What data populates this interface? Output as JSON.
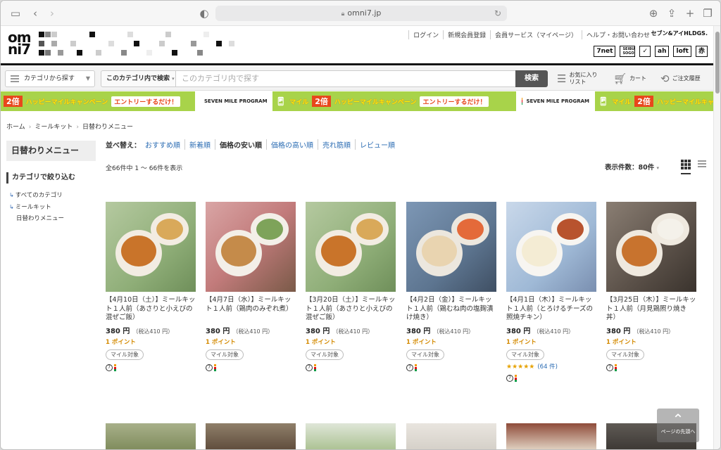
{
  "browser": {
    "url": "omni7.jp"
  },
  "header": {
    "logo_top": "om",
    "logo_bottom": "ni7",
    "links": [
      "ログイン",
      "新規会員登録",
      "会員サービス（マイページ）",
      "ヘルプ・お問い合わせ"
    ],
    "group_logo": "セブン&アイHLDGS.",
    "brands": [
      "7net",
      "SEIBU SOGO",
      "✓",
      "ah",
      "loft",
      "赤"
    ]
  },
  "search": {
    "category_button": "カテゴリから探す",
    "scope_button": "このカテゴリ内で検索",
    "placeholder": "このカテゴリ内で探す",
    "submit": "検索",
    "favorites": "お気に入り リスト",
    "cart": "カート",
    "history": "ご注文履歴"
  },
  "banner": {
    "mile": "マイル",
    "twice": "2倍",
    "campaign": "ハッピーマイルキャンペーン",
    "entry": "エントリーするだけ！",
    "program": "SEVEN MILE PROGRAM"
  },
  "breadcrumb": [
    "ホーム",
    "ミールキット",
    "日替わりメニュー"
  ],
  "sidebar": {
    "title": "日替わりメニュー",
    "filter_heading": "カテゴリで絞り込む",
    "items": [
      "すべてのカテゴリ",
      "ミールキット",
      "日替わりメニュー"
    ]
  },
  "sort": {
    "label": "並べ替え：",
    "options": [
      "おすすめ順",
      "新着順",
      "価格の安い順",
      "価格の高い順",
      "売れ筋順",
      "レビュー順"
    ]
  },
  "listing": {
    "count_text": "全66件中 1 〜 66件を表示",
    "per_page": "表示件数：80件"
  },
  "products": [
    {
      "name": "【4月10日（土）】ミールキット１人前（あさりと小えびの混ぜご飯）",
      "price": "380 円",
      "tax": "（税込410 円）",
      "points": "1  ポイント",
      "badge": "マイル対象"
    },
    {
      "name": "【4月7日（水）】ミールキット１人前（鶏肉のみぞれ煮）",
      "price": "380 円",
      "tax": "（税込410 円）",
      "points": "1  ポイント",
      "badge": "マイル対象"
    },
    {
      "name": "【3月20日（土）】ミールキット１人前（あさりと小えびの混ぜご飯）",
      "price": "380 円",
      "tax": "（税込410 円）",
      "points": "1  ポイント",
      "badge": "マイル対象"
    },
    {
      "name": "【4月2日（金）】ミールキット１人前（鶏むね肉の塩麹漬け焼き）",
      "price": "380 円",
      "tax": "（税込410 円）",
      "points": "1  ポイント",
      "badge": "マイル対象"
    },
    {
      "name": "【4月1日（木）】ミールキット１人前（とろけるチーズの照焼チキン）",
      "price": "380 円",
      "tax": "（税込410 円）",
      "points": "1  ポイント",
      "badge": "マイル対象",
      "stars": "★★★★★",
      "rating_count": "(64 件)"
    },
    {
      "name": "【3月25日（木）】ミールキット１人前（月見鶏照り焼き丼）",
      "price": "380 円",
      "tax": "（税込410 円）",
      "points": "1  ポイント",
      "badge": "マイル対象"
    }
  ],
  "pagetop": {
    "arrow": "⌃",
    "label": "ページの先頭へ"
  }
}
